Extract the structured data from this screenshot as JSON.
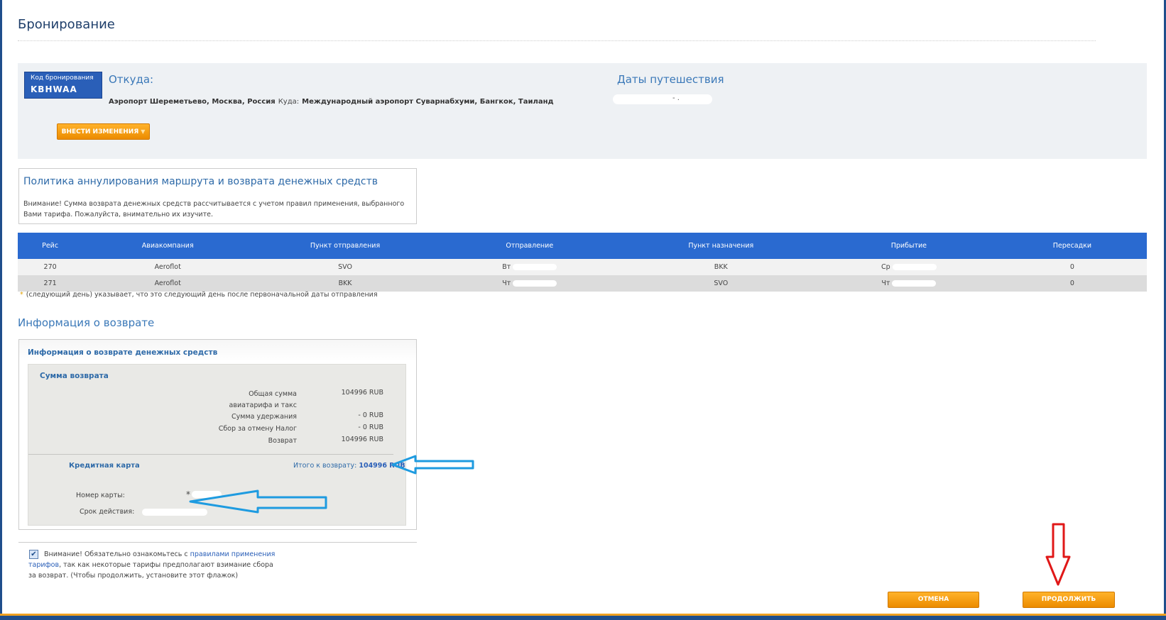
{
  "page": {
    "title": "Бронирование"
  },
  "booking": {
    "code_label": "Код бронирования",
    "code": "KBHWAA",
    "from_heading": "Откуда:",
    "dates_heading": "Даты путешествия",
    "origin": "Аэропорт Шереметьево, Москва, Россия",
    "to_label": "Куда:",
    "destination": "Международный аэропорт Суварнабхуми, Бангкок, Таиланд",
    "dates_dash": "- .",
    "change_button": "ВНЕСТИ ИЗМЕНЕНИЯ"
  },
  "policy": {
    "title": "Политика аннулирования маршрута и возврата денежных средств",
    "text": "Внимание! Сумма возврата денежных средств рассчитывается с учетом правил применения, выбранного Вами тарифа. Пожалуйста, внимательно их изучите."
  },
  "flights": {
    "headers": [
      "Рейс",
      "Авиакомпания",
      "Пункт отправления",
      "Отправление",
      "Пункт назначения",
      "Прибытие",
      "Пересадки"
    ],
    "rows": [
      {
        "flight": "270",
        "airline": "Aeroflot",
        "origin": "SVO",
        "departure": "Вт",
        "destination": "BKK",
        "arrival": "Ср",
        "stops": "0"
      },
      {
        "flight": "271",
        "airline": "Aeroflot",
        "origin": "BKK",
        "departure": "Чт",
        "destination": "SVO",
        "arrival": "Чт",
        "stops": "0"
      }
    ],
    "note_star": "*",
    "note": "(следующий день) указывает, что это следующий день после первоначальной даты отправления"
  },
  "refund": {
    "heading": "Информация о возврате",
    "box_title": "Информация о возврате денежных средств",
    "sum_title": "Сумма возврата",
    "rows": [
      {
        "label": "Общая сумма авиатарифа и такс",
        "value": "104996 RUB"
      },
      {
        "label": "Сумма удержания",
        "value": "- 0 RUB"
      },
      {
        "label": "Сбор за отмену Налог",
        "value": "- 0 RUB"
      },
      {
        "label": "Возврат",
        "value": "104996 RUB"
      }
    ],
    "payment_method": "Кредитная карта",
    "total_label": "Итого к возврату:",
    "total_value": "104996 RUB",
    "card_number_label": "Номер карты:",
    "card_number_prefix": "*",
    "expiry_label": "Срок действия:"
  },
  "acknowledgement": {
    "checked": true,
    "check_mark": "✔",
    "text_before": "Внимание! Обязательно ознакомьтесь с ",
    "link": "правилами применения тарифов",
    "text_after": ", так как некоторые тарифы предполагают взимание сбора за возврат. (Чтобы продолжить, установите этот флажок)"
  },
  "actions": {
    "cancel": "ОТМЕНА",
    "continue": "ПРОДОЛЖИТЬ"
  },
  "colors": {
    "accent": "#2a6ad0",
    "button": "#f29a10",
    "annotation_blue": "#1e9be0",
    "annotation_red": "#e01818"
  }
}
